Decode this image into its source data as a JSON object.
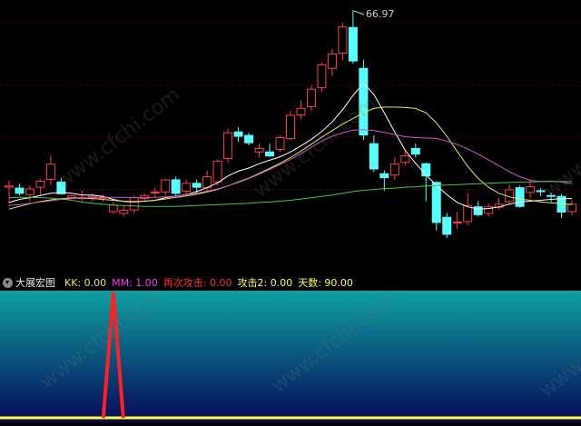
{
  "chart_data": [
    {
      "type": "candlestick",
      "title": "",
      "price_range": [
        60.9,
        67.2
      ],
      "annotations": {
        "high_label": "66.97"
      },
      "candles": [
        {
          "o": 62.93,
          "h": 63.06,
          "l": 62.53,
          "c": 62.9,
          "dir": "up"
        },
        {
          "o": 62.88,
          "h": 62.98,
          "l": 62.71,
          "c": 62.76,
          "dir": "down"
        },
        {
          "o": 62.73,
          "h": 62.94,
          "l": 62.58,
          "c": 62.86,
          "dir": "up"
        },
        {
          "o": 62.9,
          "h": 63.08,
          "l": 62.73,
          "c": 63.04,
          "dir": "up"
        },
        {
          "o": 63.08,
          "h": 63.63,
          "l": 62.95,
          "c": 63.43,
          "dir": "up"
        },
        {
          "o": 63.02,
          "h": 63.12,
          "l": 62.73,
          "c": 62.75,
          "dir": "down"
        },
        {
          "o": 62.7,
          "h": 62.73,
          "l": 62.63,
          "c": 62.66,
          "dir": "up"
        },
        {
          "o": 62.64,
          "h": 62.82,
          "l": 62.58,
          "c": 62.66,
          "dir": "up"
        },
        {
          "o": 62.69,
          "h": 62.76,
          "l": 62.58,
          "c": 62.66,
          "dir": "up"
        },
        {
          "o": 62.65,
          "h": 62.74,
          "l": 62.56,
          "c": 62.67,
          "dir": "up"
        },
        {
          "o": 62.34,
          "h": 62.56,
          "l": 62.29,
          "c": 62.49,
          "dir": "up"
        },
        {
          "o": 62.3,
          "h": 62.49,
          "l": 62.23,
          "c": 62.37,
          "dir": "up"
        },
        {
          "o": 62.38,
          "h": 62.71,
          "l": 62.3,
          "c": 62.66,
          "dir": "up"
        },
        {
          "o": 62.64,
          "h": 62.76,
          "l": 62.56,
          "c": 62.71,
          "dir": "up"
        },
        {
          "o": 62.77,
          "h": 62.89,
          "l": 62.66,
          "c": 62.79,
          "dir": "up"
        },
        {
          "o": 62.79,
          "h": 63.1,
          "l": 62.71,
          "c": 63.07,
          "dir": "up"
        },
        {
          "o": 63.07,
          "h": 63.14,
          "l": 62.71,
          "c": 62.76,
          "dir": "down"
        },
        {
          "o": 62.81,
          "h": 63.07,
          "l": 62.71,
          "c": 62.99,
          "dir": "up"
        },
        {
          "o": 62.99,
          "h": 63.08,
          "l": 62.77,
          "c": 62.9,
          "dir": "down"
        },
        {
          "o": 62.89,
          "h": 63.28,
          "l": 62.82,
          "c": 63.14,
          "dir": "up"
        },
        {
          "o": 63.02,
          "h": 63.54,
          "l": 62.94,
          "c": 63.5,
          "dir": "up"
        },
        {
          "o": 63.56,
          "h": 64.25,
          "l": 63.46,
          "c": 64.15,
          "dir": "up"
        },
        {
          "o": 64.17,
          "h": 64.28,
          "l": 63.94,
          "c": 64.07,
          "dir": "down"
        },
        {
          "o": 64.09,
          "h": 64.15,
          "l": 63.86,
          "c": 63.92,
          "dir": "down"
        },
        {
          "o": 63.71,
          "h": 63.9,
          "l": 63.59,
          "c": 63.79,
          "dir": "up"
        },
        {
          "o": 63.71,
          "h": 63.9,
          "l": 63.59,
          "c": 63.62,
          "dir": "down"
        },
        {
          "o": 63.77,
          "h": 64.09,
          "l": 63.71,
          "c": 64.04,
          "dir": "up"
        },
        {
          "o": 64.02,
          "h": 64.65,
          "l": 63.98,
          "c": 64.55,
          "dir": "up"
        },
        {
          "o": 64.56,
          "h": 64.9,
          "l": 64.46,
          "c": 64.71,
          "dir": "up"
        },
        {
          "o": 64.75,
          "h": 65.25,
          "l": 64.66,
          "c": 65.15,
          "dir": "up"
        },
        {
          "o": 65.19,
          "h": 65.76,
          "l": 65.08,
          "c": 65.71,
          "dir": "up"
        },
        {
          "o": 65.63,
          "h": 66.08,
          "l": 65.46,
          "c": 65.96,
          "dir": "up"
        },
        {
          "o": 65.98,
          "h": 66.68,
          "l": 65.82,
          "c": 66.58,
          "dir": "up"
        },
        {
          "o": 66.57,
          "h": 66.97,
          "l": 65.74,
          "c": 65.8,
          "dir": "down"
        },
        {
          "o": 65.63,
          "h": 65.83,
          "l": 63.98,
          "c": 64.1,
          "dir": "down"
        },
        {
          "o": 63.9,
          "h": 64.09,
          "l": 63.25,
          "c": 63.32,
          "dir": "down"
        },
        {
          "o": 63.21,
          "h": 63.29,
          "l": 62.82,
          "c": 63.12,
          "dir": "down"
        },
        {
          "o": 63.18,
          "h": 63.59,
          "l": 63.07,
          "c": 63.43,
          "dir": "up"
        },
        {
          "o": 63.47,
          "h": 63.76,
          "l": 63.4,
          "c": 63.62,
          "dir": "up"
        },
        {
          "o": 63.79,
          "h": 63.9,
          "l": 63.59,
          "c": 63.66,
          "dir": "down"
        },
        {
          "o": 63.44,
          "h": 63.47,
          "l": 62.58,
          "c": 63.16,
          "dir": "down"
        },
        {
          "o": 63.01,
          "h": 63.04,
          "l": 61.91,
          "c": 62.09,
          "dir": "down"
        },
        {
          "o": 62.21,
          "h": 62.31,
          "l": 61.73,
          "c": 61.82,
          "dir": "down"
        },
        {
          "o": 62.1,
          "h": 62.34,
          "l": 61.94,
          "c": 62.1,
          "dir": "up"
        },
        {
          "o": 62.11,
          "h": 62.76,
          "l": 62.02,
          "c": 62.48,
          "dir": "up"
        },
        {
          "o": 62.45,
          "h": 62.58,
          "l": 62.23,
          "c": 62.27,
          "dir": "down"
        },
        {
          "o": 62.3,
          "h": 62.53,
          "l": 62.23,
          "c": 62.45,
          "dir": "up"
        },
        {
          "o": 62.44,
          "h": 62.66,
          "l": 62.38,
          "c": 62.51,
          "dir": "up"
        },
        {
          "o": 62.57,
          "h": 62.96,
          "l": 62.51,
          "c": 62.84,
          "dir": "up"
        },
        {
          "o": 62.89,
          "h": 62.94,
          "l": 62.43,
          "c": 62.46,
          "dir": "down"
        },
        {
          "o": 62.78,
          "h": 63.07,
          "l": 62.66,
          "c": 62.91,
          "dir": "up"
        },
        {
          "o": 62.82,
          "h": 62.88,
          "l": 62.69,
          "c": 62.8,
          "dir": "down"
        },
        {
          "o": 62.71,
          "h": 62.78,
          "l": 62.56,
          "c": 62.69,
          "dir": "down"
        },
        {
          "o": 62.69,
          "h": 62.74,
          "l": 62.19,
          "c": 62.33,
          "dir": "down"
        },
        {
          "o": 62.34,
          "h": 62.6,
          "l": 62.26,
          "c": 62.51,
          "dir": "up"
        }
      ],
      "series": [
        {
          "color": "#ffffff",
          "values": [
            62.55,
            62.62,
            62.66,
            62.71,
            62.76,
            62.78,
            62.76,
            62.72,
            62.72,
            62.69,
            62.62,
            62.57,
            62.56,
            62.58,
            62.6,
            62.66,
            62.7,
            62.73,
            62.8,
            62.89,
            63.0,
            63.16,
            63.27,
            63.34,
            63.44,
            63.52,
            63.6,
            63.71,
            63.85,
            64.0,
            64.18,
            64.4,
            64.68,
            65.01,
            65.29,
            65.03,
            64.61,
            64.17,
            63.75,
            63.45,
            63.18,
            62.95,
            62.73,
            62.55,
            62.45,
            62.4,
            62.41,
            62.45,
            62.51,
            62.56,
            62.58,
            62.6,
            62.62,
            62.64,
            62.64
          ]
        },
        {
          "color": "#e8e84a",
          "values": [
            62.4,
            62.46,
            62.52,
            62.57,
            62.61,
            62.64,
            62.65,
            62.65,
            62.64,
            62.62,
            62.6,
            62.58,
            62.57,
            62.58,
            62.6,
            62.63,
            62.67,
            62.7,
            62.74,
            62.79,
            62.85,
            62.93,
            63.02,
            63.11,
            63.22,
            63.33,
            63.45,
            63.58,
            63.73,
            63.89,
            64.05,
            64.2,
            64.35,
            64.48,
            64.61,
            64.71,
            64.74,
            64.74,
            64.73,
            64.71,
            64.61,
            64.38,
            64.07,
            63.72,
            63.38,
            63.1,
            62.9,
            62.76,
            62.68,
            62.63,
            62.6,
            62.56,
            62.54,
            62.52,
            62.5
          ]
        },
        {
          "color": "#d050d0",
          "values": [
            62.48,
            62.5,
            62.53,
            62.56,
            62.59,
            62.62,
            62.64,
            62.65,
            62.66,
            62.67,
            62.67,
            62.67,
            62.66,
            62.66,
            62.67,
            62.68,
            62.7,
            62.73,
            62.76,
            62.81,
            62.86,
            62.93,
            63.01,
            63.1,
            63.2,
            63.31,
            63.42,
            63.54,
            63.67,
            63.82,
            63.96,
            64.07,
            64.15,
            64.21,
            64.22,
            64.2,
            64.16,
            64.11,
            64.06,
            64.04,
            64.03,
            64.02,
            63.96,
            63.88,
            63.78,
            63.66,
            63.53,
            63.39,
            63.26,
            63.14,
            63.06,
            63.03,
            63.04,
            63.02,
            62.98
          ]
        },
        {
          "color": "#3cc83c",
          "values": [
            62.66,
            62.67,
            62.67,
            62.66,
            62.65,
            62.63,
            62.6,
            62.56,
            62.53,
            62.51,
            62.49,
            62.48,
            62.47,
            62.46,
            62.46,
            62.46,
            62.46,
            62.47,
            62.48,
            62.49,
            62.5,
            62.51,
            62.52,
            62.53,
            62.55,
            62.56,
            62.58,
            62.6,
            62.63,
            62.66,
            62.69,
            62.72,
            62.76,
            62.8,
            62.83,
            62.85,
            62.87,
            62.88,
            62.9,
            62.91,
            62.93,
            62.94,
            62.95,
            62.96,
            62.97,
            62.98,
            62.99,
            63.0,
            63.01,
            63.02,
            63.02,
            63.03,
            63.03,
            63.03,
            63.03
          ]
        }
      ],
      "grid": true
    },
    {
      "type": "line",
      "title": "大展宏图",
      "y_range": [
        0,
        90
      ],
      "series": [
        {
          "name": "KK",
          "color": "#ffffff",
          "values": []
        },
        {
          "name": "MM",
          "color": "#ff33ff",
          "values": []
        },
        {
          "name": "再次攻击",
          "color": "#ff2020",
          "values": [
            0,
            0,
            0,
            0,
            0,
            0,
            0,
            0,
            0,
            0,
            0,
            0,
            0,
            0,
            0,
            0,
            0,
            0,
            0,
            0,
            0,
            0,
            0,
            0,
            0,
            0,
            0,
            0,
            0,
            0,
            0,
            0,
            0,
            0,
            0,
            0,
            0,
            0,
            0,
            0,
            0,
            0,
            0,
            0,
            0,
            0,
            0,
            0,
            0,
            0,
            0,
            0,
            0,
            0,
            0
          ]
        },
        {
          "name": "攻击2",
          "color": "#ffff33",
          "values": []
        }
      ],
      "spike": {
        "index": 10,
        "value": 90
      },
      "baseline_color": "#ffff33",
      "colors": {
        "gradient_top": "#0fa0a0",
        "gradient_bottom": "#050a5a"
      }
    }
  ],
  "indicator": {
    "name": "大展宏图",
    "params": [
      {
        "label": "KK: 0.00",
        "color": "#e8e84a"
      },
      {
        "label": "MM: 1.00",
        "color": "#ff33ff"
      },
      {
        "label": "再次攻击: 0.00",
        "color": "#ff3030"
      },
      {
        "label": "攻击2: 0.00",
        "color": "#ffff33"
      },
      {
        "label": "天数: 90.00",
        "color": "#ffff33"
      }
    ]
  },
  "colors": {
    "up_candle": "#ff3b3b",
    "down_candle": "#54ffff",
    "grid": "#7a0000"
  },
  "watermark": "www.cfchi.com"
}
